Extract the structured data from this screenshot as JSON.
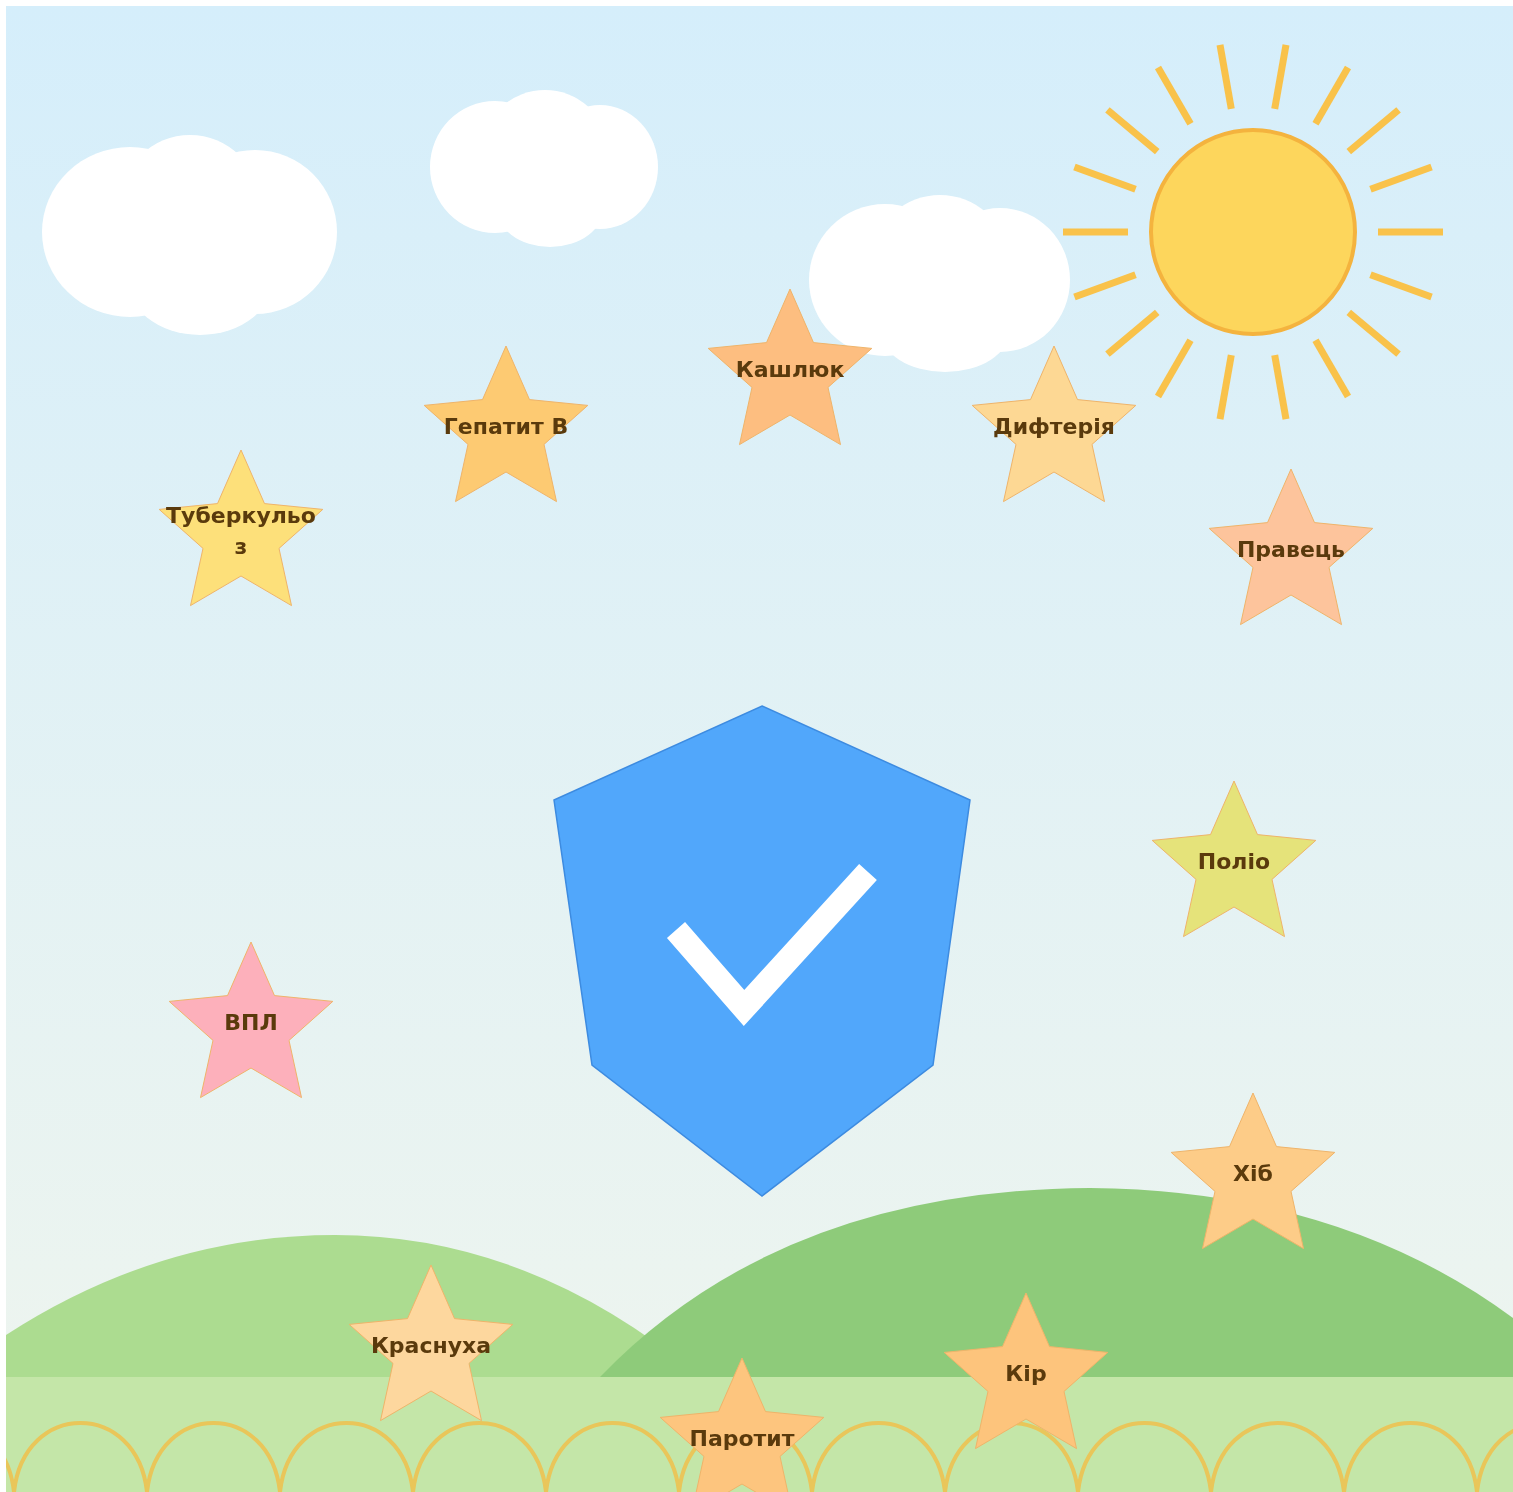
{
  "stars": [
    {
      "lines": [
        "Туберкульо",
        "з"
      ],
      "color": "#fde07a"
    },
    {
      "lines": [
        "Гепатит B"
      ],
      "color": "#fdca72"
    },
    {
      "lines": [
        "Кашлюк"
      ],
      "color": "#fdbe80"
    },
    {
      "lines": [
        "Дифтерія"
      ],
      "color": "#fdd894"
    },
    {
      "lines": [
        "Правець"
      ],
      "color": "#fdc49c"
    },
    {
      "lines": [
        "Поліо"
      ],
      "color": "#e5e37a"
    },
    {
      "lines": [
        "ВПЛ"
      ],
      "color": "#fdb0bb"
    },
    {
      "lines": [
        "Хіб"
      ],
      "color": "#fdcc88"
    },
    {
      "lines": [
        "Краснуха"
      ],
      "color": "#fdd79e"
    },
    {
      "lines": [
        "Кір"
      ],
      "color": "#fdc47c"
    },
    {
      "lines": [
        "Паротит"
      ],
      "color": "#fdc57e"
    }
  ]
}
